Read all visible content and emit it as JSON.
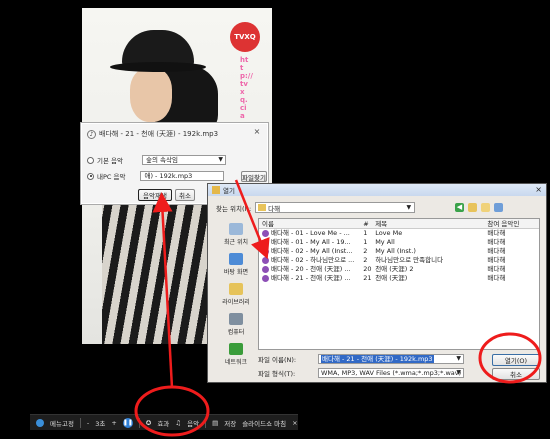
{
  "photo": {
    "logo_text": "TVXQ",
    "watermark": "http://tvxq.ciao.ro"
  },
  "music_dialog": {
    "title": "배다해 - 21 - 천애 (天涯) - 192k.mp3",
    "close": "×",
    "basic_music_label": "기본 음악",
    "basic_music_value": "숲의 속삭임",
    "my_pc_music_label": "내PC 음악",
    "my_pc_music_value": "애) - 192k.mp3",
    "find_file_button": "파일찾기",
    "apply_button": "음악재생",
    "cancel_button": "취소"
  },
  "open_dialog": {
    "title": "열기",
    "close": "×",
    "look_in_label": "찾는 위치(I):",
    "look_in_value": "다해",
    "places": [
      {
        "label": "최근 위치",
        "color": "#9bb8d9"
      },
      {
        "label": "바탕 화면",
        "color": "#4d8bd6"
      },
      {
        "label": "라이브러리",
        "color": "#e6c35a"
      },
      {
        "label": "컴퓨터",
        "color": "#7f8f9f"
      },
      {
        "label": "네트워크",
        "color": "#3a9c3a"
      }
    ],
    "columns": [
      "이름",
      "#",
      "제목",
      "참여 음악인"
    ],
    "files": [
      {
        "name": "배다해 - 01 - Love Me - ...",
        "num": "1",
        "title": "Love Me",
        "artist": "배다해"
      },
      {
        "name": "배다해 - 01 - My All - 19...",
        "num": "1",
        "title": "My All",
        "artist": "배다해"
      },
      {
        "name": "배다해 - 02 - My All (Inst...",
        "num": "2",
        "title": "My All (Inst.)",
        "artist": "배다해"
      },
      {
        "name": "배다해 - 02 - 하나님만으로 ...",
        "num": "2",
        "title": "하나님만으로 만족합니다",
        "artist": "배다해"
      },
      {
        "name": "배다해 - 20 - 천애 (天涯) ...",
        "num": "20",
        "title": "천애 (天涯) 2",
        "artist": "배다해"
      },
      {
        "name": "배다해 - 21 - 천애 (天涯) ...",
        "num": "21",
        "title": "천애 (天涯)",
        "artist": "배다해"
      }
    ],
    "filename_label": "파일 이름(N):",
    "filename_value": "배다해 - 21 - 천애 (天涯) - 192k.mp3",
    "filetype_label": "파일 형식(T):",
    "filetype_value": "WMA, MP3, WAV Files (*.wma;*.mp3;*.wav)",
    "open_button": "열기(O)",
    "cancel_button": "취소"
  },
  "toolbar": {
    "menu_label": "메뉴고정",
    "interval": "3초",
    "effects_label": "효과",
    "music_label": "음악",
    "save_label": "저장",
    "slideshow_label": "슬라이드쇼 마침",
    "close": "×"
  },
  "annotation": {
    "color": "#ee1c1c"
  }
}
